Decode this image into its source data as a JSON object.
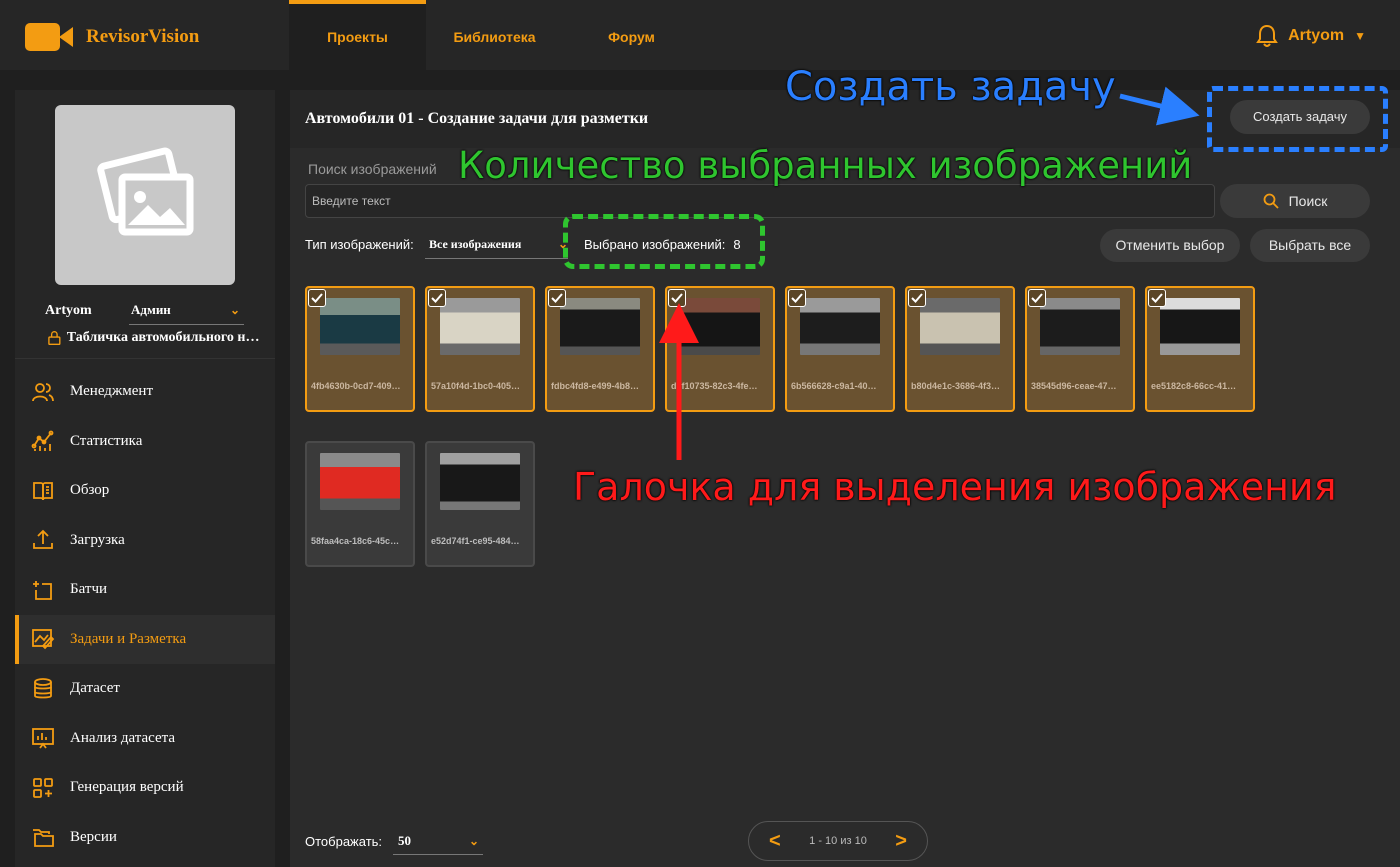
{
  "app": {
    "name": "RevisorVision"
  },
  "nav": {
    "tabs": [
      "Проекты",
      "Библиотека",
      "Форум"
    ]
  },
  "user": {
    "name": "Artyom",
    "role": "Админ",
    "project": "Табличка автомобильного номера"
  },
  "menu": [
    {
      "label": "Менеджмент",
      "icon": "users-icon"
    },
    {
      "label": "Статистика",
      "icon": "stats-icon"
    },
    {
      "label": "Обзор",
      "icon": "book-icon"
    },
    {
      "label": "Загрузка",
      "icon": "upload-icon"
    },
    {
      "label": "Батчи",
      "icon": "batch-icon"
    },
    {
      "label": "Задачи и Разметка",
      "icon": "annotate-icon"
    },
    {
      "label": "Датасет",
      "icon": "database-icon"
    },
    {
      "label": "Анализ датасета",
      "icon": "analysis-icon"
    },
    {
      "label": "Генерация версий",
      "icon": "generate-icon"
    },
    {
      "label": "Версии",
      "icon": "folders-icon"
    }
  ],
  "page": {
    "title": "Автомобили 01 - Создание задачи для разметки",
    "create_button": "Создать задачу"
  },
  "search": {
    "label": "Поиск изображений",
    "placeholder": "Введите текст",
    "button": "Поиск"
  },
  "filters": {
    "type_label": "Тип изображений:",
    "type_value": "Все изображения",
    "selected_label": "Выбрано изображений:",
    "selected_count": "8",
    "clear_button": "Отменить выбор",
    "select_all_button": "Выбрать все"
  },
  "images": [
    {
      "caption": "4fb4630b-0cd7-409…",
      "selected": true,
      "color": "#1a3a44"
    },
    {
      "caption": "57a10f4d-1bc0-405…",
      "selected": true,
      "color": "#d9d4c5"
    },
    {
      "caption": "fdbc4fd8-e499-4b8…",
      "selected": true,
      "color": "#1a1a1a"
    },
    {
      "caption": "d4f10735-82c3-4fe…",
      "selected": true,
      "color": "#151515"
    },
    {
      "caption": "6b566628-c9a1-40…",
      "selected": true,
      "color": "#1d1d1d"
    },
    {
      "caption": "b80d4e1c-3686-4f3…",
      "selected": true,
      "color": "#c9c2b0"
    },
    {
      "caption": "38545d96-ceae-47…",
      "selected": true,
      "color": "#1c1c1c"
    },
    {
      "caption": "ee5182c8-66cc-41…",
      "selected": true,
      "color": "#171717"
    },
    {
      "caption": "58faa4ca-18c6-45c…",
      "selected": false,
      "color": "#e02a22"
    },
    {
      "caption": "e52d74f1-ce95-484…",
      "selected": false,
      "color": "#181818"
    }
  ],
  "footer": {
    "show_label": "Отображать:",
    "show_value": "50",
    "pager_info": "1 - 10 из 10"
  },
  "annotations": {
    "create_task": "Создать задачу",
    "selected_count": "Количество выбранных изображений",
    "checkbox": "Галочка для выделения изображения"
  },
  "colors": {
    "accent": "#f39c12",
    "blue": "#2a7fff",
    "green": "#2fc52f",
    "red": "#ff1a1a"
  }
}
